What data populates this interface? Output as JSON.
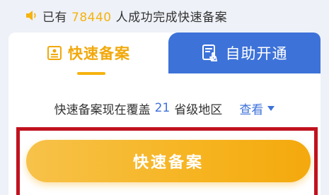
{
  "notice": {
    "prefix": "已有",
    "count": "78440",
    "suffix": "人成功完成快速备案",
    "icon": "speaker-icon"
  },
  "tabs": [
    {
      "label": "快速备案",
      "icon": "document-icon",
      "active": true
    },
    {
      "label": "自助开通",
      "icon": "touch-document-icon",
      "active": false
    }
  ],
  "coverage": {
    "prefix": "快速备案现在覆盖",
    "count": "21",
    "suffix": "省级地区",
    "view_label": "查看"
  },
  "main_button": {
    "label": "快速备案"
  },
  "colors": {
    "accent_yellow": "#f5b30f",
    "accent_blue": "#3d72d9",
    "highlight_red": "#c0121e"
  }
}
